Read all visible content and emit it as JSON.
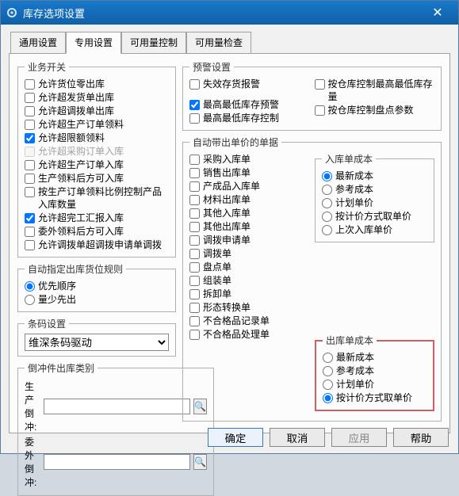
{
  "window": {
    "title": "库存选项设置"
  },
  "tabs": [
    "通用设置",
    "专用设置",
    "可用量控制",
    "可用量检查"
  ],
  "activeTab": 1,
  "groups": {
    "businessSwitch": "业务开关",
    "autoOutRule": "自动指定出库货位规则",
    "barcode": "条码设置",
    "flushType": "倒冲件出库类别",
    "warnSetting": "预警设置",
    "autoPrice": "自动带出单价的单据",
    "inCost": "入库单成本",
    "outCost": "出库单成本"
  },
  "businessSwitch": {
    "chk1": "允许货位零出库",
    "chk2": "允许超发货单出库",
    "chk3": "允许超调拨单出库",
    "chk4": "允许超生产订单领料",
    "chk5": "允许超限额领料",
    "chk6": "允许超采购订单入库",
    "chk7": "允许超生产订单入库",
    "chk8": "生产领料后方可入库",
    "chk9": "按生产订单领料比例控制产品入库数量",
    "chk10": "允许超完工汇报入库",
    "chk11": "委外领料后方可入库",
    "chk12": "允许调拨单超调拨申请单调拨",
    "v": {
      "chk1": false,
      "chk2": false,
      "chk3": false,
      "chk4": false,
      "chk5": true,
      "chk6": false,
      "chk7": false,
      "chk8": false,
      "chk9": false,
      "chk10": true,
      "chk11": false,
      "chk12": false
    }
  },
  "autoOutRule": {
    "opt1": "优先顺序",
    "opt2": "量少先出",
    "value": "opt1"
  },
  "barcode": {
    "selected": "维深条码驱动"
  },
  "flushType": {
    "lbl1": "生产倒冲:",
    "lbl2": "委外倒冲:",
    "v1": "",
    "v2": ""
  },
  "warnSetting": {
    "chk1": "失效存货报警",
    "chk2": "最高最低库存预警",
    "chk3": "最高最低库存控制",
    "chk4": "按仓库控制最高最低库存量",
    "chk5": "按仓库控制盘点参数",
    "v": {
      "chk1": false,
      "chk2": true,
      "chk3": false,
      "chk4": false,
      "chk5": false
    }
  },
  "autoPrice": {
    "chk1": "采购入库单",
    "chk2": "销售出库单",
    "chk3": "产成品入库单",
    "chk4": "材料出库单",
    "chk5": "其他入库单",
    "chk6": "其他出库单",
    "chk7": "调拨申请单",
    "chk8": "调拨单",
    "chk9": "盘点单",
    "chk10": "组装单",
    "chk11": "拆卸单",
    "chk12": "形态转换单",
    "chk13": "不合格品记录单",
    "chk14": "不合格品处理单",
    "v": {
      "chk1": false,
      "chk2": false,
      "chk3": false,
      "chk4": false,
      "chk5": false,
      "chk6": false,
      "chk7": false,
      "chk8": false,
      "chk9": false,
      "chk10": false,
      "chk11": false,
      "chk12": false,
      "chk13": false,
      "chk14": false
    }
  },
  "inCost": {
    "opt1": "最新成本",
    "opt2": "参考成本",
    "opt3": "计划单价",
    "opt4": "按计价方式取单价",
    "opt5": "上次入库单价",
    "value": "opt1"
  },
  "outCost": {
    "opt1": "最新成本",
    "opt2": "参考成本",
    "opt3": "计划单价",
    "opt4": "按计价方式取单价",
    "value": "opt4"
  },
  "buttons": {
    "ok": "确定",
    "cancel": "取消",
    "apply": "应用",
    "help": "帮助"
  },
  "iconNames": {
    "app": "gear-icon",
    "close": "close-icon",
    "search": "search-icon"
  }
}
